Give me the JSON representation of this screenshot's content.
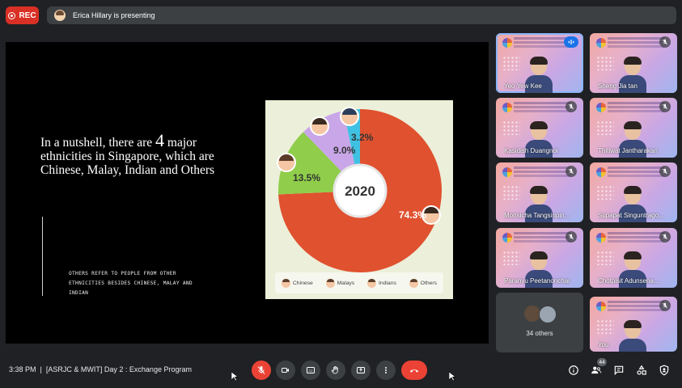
{
  "top_bar": {
    "rec_label": "REC",
    "presenting_text": "Erica Hillary is presenting"
  },
  "slide": {
    "heading_part1": "In a nutshell, there are ",
    "heading_number": "4",
    "heading_part2": " major ethnicities in Singapore, which are Chinese, Malay, Indian and Others",
    "note": "Others refer to people from other ethnicities besides Chinese, Malay and Indian"
  },
  "chart_data": {
    "type": "pie",
    "center_label": "2020",
    "categories": [
      "Chinese",
      "Malays",
      "Indians",
      "Others"
    ],
    "values": [
      74.3,
      13.5,
      9.0,
      3.2
    ],
    "value_labels": [
      "74.3%",
      "13.5%",
      "9.0%",
      "3.2%"
    ],
    "colors": [
      "#e0512f",
      "#8fcd4a",
      "#c9a6e8",
      "#3fc1e3"
    ],
    "legend": [
      "Chinese",
      "Malays",
      "Indians",
      "Others"
    ]
  },
  "participants": [
    {
      "name": "Yeo Yew Kee",
      "speaking": true
    },
    {
      "name": "Sheng Jia tan",
      "muted": true
    },
    {
      "name": "Kasidish Duangnoi",
      "muted": true
    },
    {
      "name": "Thitiwat Jantharakan",
      "muted": true
    },
    {
      "name": "Monsicha Tangsiripin...",
      "muted": true
    },
    {
      "name": "Supapat Singuntrago...",
      "muted": true
    },
    {
      "name": "Paranyu Peetanonchai",
      "muted": true
    },
    {
      "name": "Chotpisit Adunsena...",
      "muted": true
    },
    {
      "name": "You",
      "muted": true
    }
  ],
  "others_tile": {
    "label": "34 others"
  },
  "bottom_bar": {
    "time": "3:38 PM",
    "separator": "|",
    "meeting_title": "[ASRJC & MWIT] Day 2 : Exchange Program",
    "people_count": "44"
  }
}
